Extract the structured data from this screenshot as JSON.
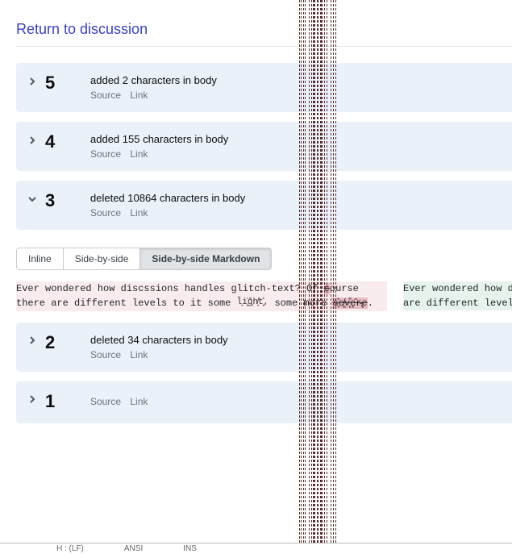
{
  "return_link": "Return to discussion",
  "revisions": [
    {
      "num": "5",
      "msg": "added 2 characters in body",
      "source": "Source",
      "link": "Link",
      "expanded": false
    },
    {
      "num": "4",
      "msg": "added 155 characters in body",
      "source": "Source",
      "link": "Link",
      "expanded": false
    },
    {
      "num": "3",
      "msg": "deleted 10864 characters in body",
      "source": "Source",
      "link": "Link",
      "expanded": true
    },
    {
      "num": "2",
      "msg": "deleted 34 characters in body",
      "source": "Source",
      "link": "Link",
      "expanded": false
    },
    {
      "num": "1",
      "msg": "",
      "source": "Source",
      "link": "Link",
      "expanded": false
    }
  ],
  "view_modes": {
    "inline": "Inline",
    "sbs": "Side-by-side",
    "sbsmd": "Side-by-side Markdown",
    "active": "sbsmd"
  },
  "diff": {
    "left_plain1": "Ever wondered how discssions handles glitch-text? Of ",
    "left_removed_inline1": "c",
    "left_plain2": "ourse there are different levels to it some ",
    "left_marks": "l̟̈i͈͑g̐ͅh̸̟t̟͛,",
    "left_plain3": " some more ",
    "left_removed_inline2": "s͉͛e̸͚v͈͒ę̑r̴̢e",
    "left_plain4": ".",
    "right_lines": [
      "Ever wondered how d",
      "are different level"
    ]
  },
  "footer": {
    "a": "H : (LF)",
    "b": "ANSI",
    "c": "INS"
  }
}
